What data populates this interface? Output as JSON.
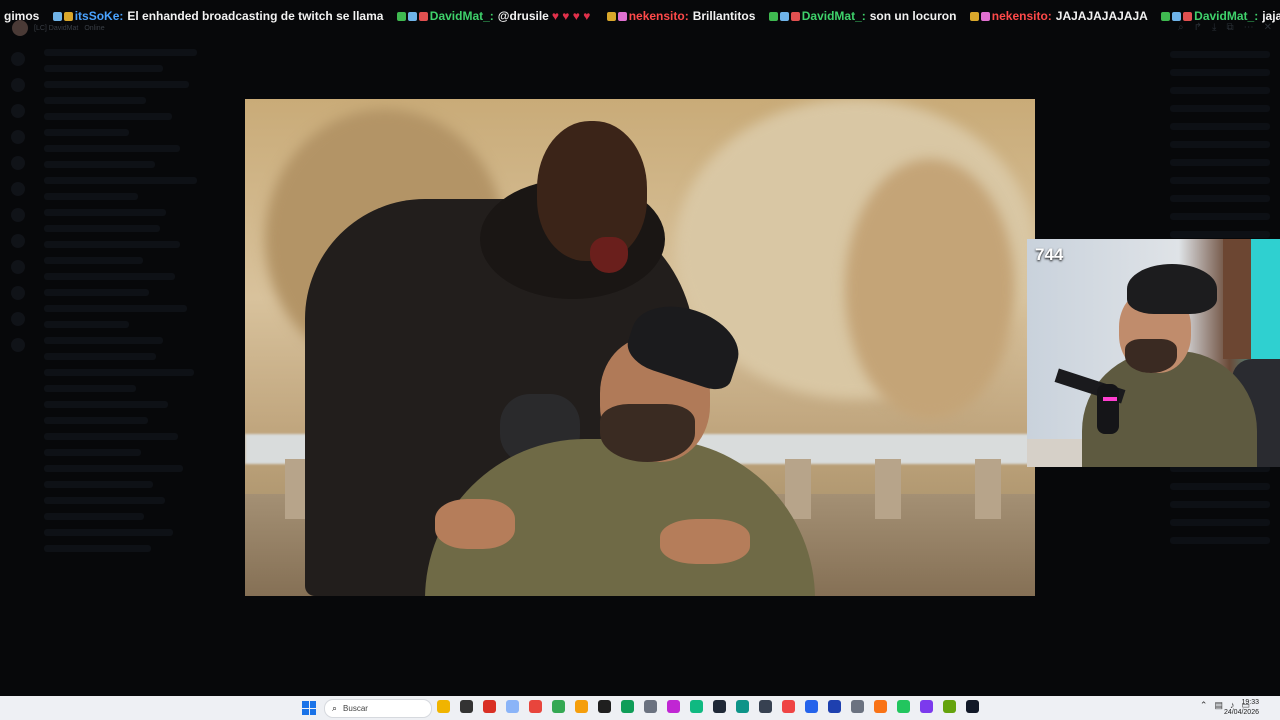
{
  "ticker": {
    "messages": [
      {
        "user": "",
        "text": "gimos",
        "user_color": "#ffffff"
      },
      {
        "user": "itsSoKe:",
        "text": "El enhanded broadcasting de twitch se llama",
        "user_color": "#4aa3ff"
      },
      {
        "user": "DavidMat_:",
        "text": "@drusile",
        "user_color": "#3fd16b"
      },
      {
        "user": "nekensito:",
        "text": "Brillantitos",
        "user_color": "#ff4a4a"
      },
      {
        "user": "DavidMat_:",
        "text": "son un locuron",
        "user_color": "#3fd16b"
      },
      {
        "user": "nekensito:",
        "text": "JAJAJAJAJAJA",
        "user_color": "#ff4a4a"
      },
      {
        "user": "DavidMat_:",
        "text": "jajaja",
        "user_color": "#3fd16b"
      }
    ]
  },
  "background_app": {
    "user_label": "[LC] DavidMat",
    "user_status": "Online"
  },
  "webcam": {
    "viewer_count": "744"
  },
  "taskbar": {
    "search_placeholder": "Buscar",
    "time": "19:33",
    "date": "24/04/2026",
    "app_colors": [
      "#f0b400",
      "#333333",
      "#d93025",
      "#8ab4f8",
      "#e8453c",
      "#34a853",
      "#f59e0b",
      "#1f1f1f",
      "#0f9d58",
      "#6b7280",
      "#c026d3",
      "#10b981",
      "#1f2937",
      "#0d9488",
      "#374151",
      "#ef4444",
      "#2563eb",
      "#1e40af",
      "#6b7280",
      "#f97316",
      "#22c55e",
      "#7c3aed",
      "#65a30d",
      "#111827"
    ]
  }
}
